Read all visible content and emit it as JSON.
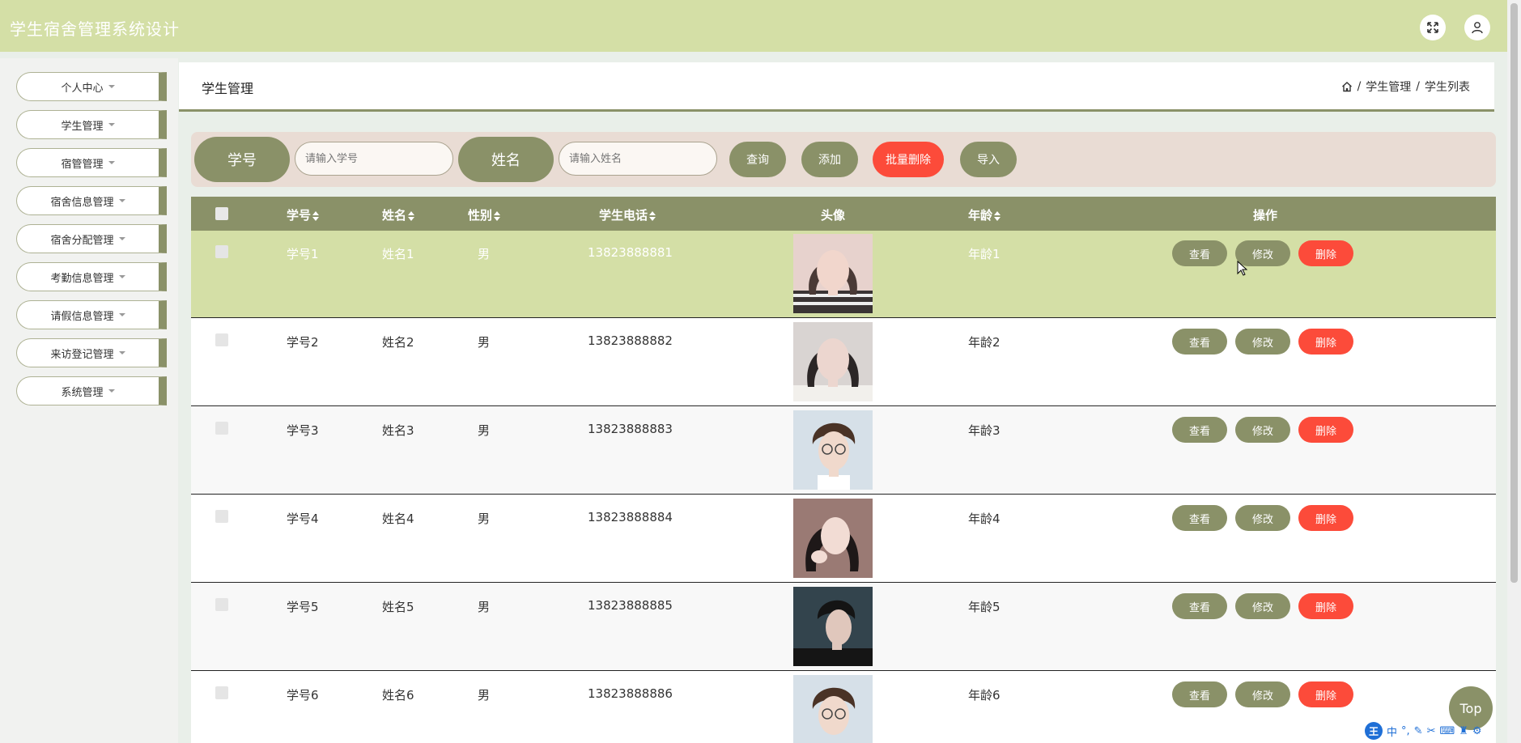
{
  "app": {
    "title": "学生宿舍管理系统设计"
  },
  "topbar": {
    "fullscreen_icon": "expand-icon",
    "user_icon": "user-icon"
  },
  "sidebar": {
    "items": [
      {
        "label": "个人中心"
      },
      {
        "label": "学生管理"
      },
      {
        "label": "宿管管理"
      },
      {
        "label": "宿舍信息管理"
      },
      {
        "label": "宿舍分配管理"
      },
      {
        "label": "考勤信息管理"
      },
      {
        "label": "请假信息管理"
      },
      {
        "label": "来访登记管理"
      },
      {
        "label": "系统管理"
      }
    ]
  },
  "header": {
    "title": "学生管理",
    "breadcrumb": {
      "home_icon": "home-icon",
      "level1": "学生管理",
      "level2": "学生列表",
      "separator": "/"
    }
  },
  "search": {
    "student_id_label": "学号",
    "student_id_placeholder": "请输入学号",
    "name_label": "姓名",
    "name_placeholder": "请输入姓名",
    "query_label": "查询",
    "add_label": "添加",
    "batch_delete_label": "批量删除",
    "import_label": "导入"
  },
  "table": {
    "columns": {
      "student_id": "学号",
      "name": "姓名",
      "gender": "性别",
      "phone": "学生电话",
      "avatar": "头像",
      "age": "年龄",
      "actions": "操作"
    },
    "action_labels": {
      "view": "查看",
      "edit": "修改",
      "delete": "删除"
    },
    "rows": [
      {
        "student_id": "学号1",
        "name": "姓名1",
        "gender": "男",
        "phone": "13823888881",
        "age": "年龄1",
        "avatar_color": "#caa4a0"
      },
      {
        "student_id": "学号2",
        "name": "姓名2",
        "gender": "男",
        "phone": "13823888882",
        "age": "年龄2",
        "avatar_color": "#bfb6b3"
      },
      {
        "student_id": "学号3",
        "name": "姓名3",
        "gender": "男",
        "phone": "13823888883",
        "age": "年龄3",
        "avatar_color": "#c9d3dc"
      },
      {
        "student_id": "学号4",
        "name": "姓名4",
        "gender": "男",
        "phone": "13823888884",
        "age": "年龄4",
        "avatar_color": "#8d6b66"
      },
      {
        "student_id": "学号5",
        "name": "姓名5",
        "gender": "男",
        "phone": "13823888885",
        "age": "年龄5",
        "avatar_color": "#2f3d46"
      },
      {
        "student_id": "学号6",
        "name": "姓名6",
        "gender": "男",
        "phone": "13823888886",
        "age": "年龄6",
        "avatar_color": "#c9d3dc"
      }
    ]
  },
  "back_to_top": {
    "label": "Top"
  },
  "ime": {
    "logo": "王",
    "mode": "中"
  },
  "colors": {
    "accent": "#8a9168",
    "topbar": "#d4dfa6",
    "danger": "#fc4b3a",
    "search_bg": "#e9dcd4"
  }
}
